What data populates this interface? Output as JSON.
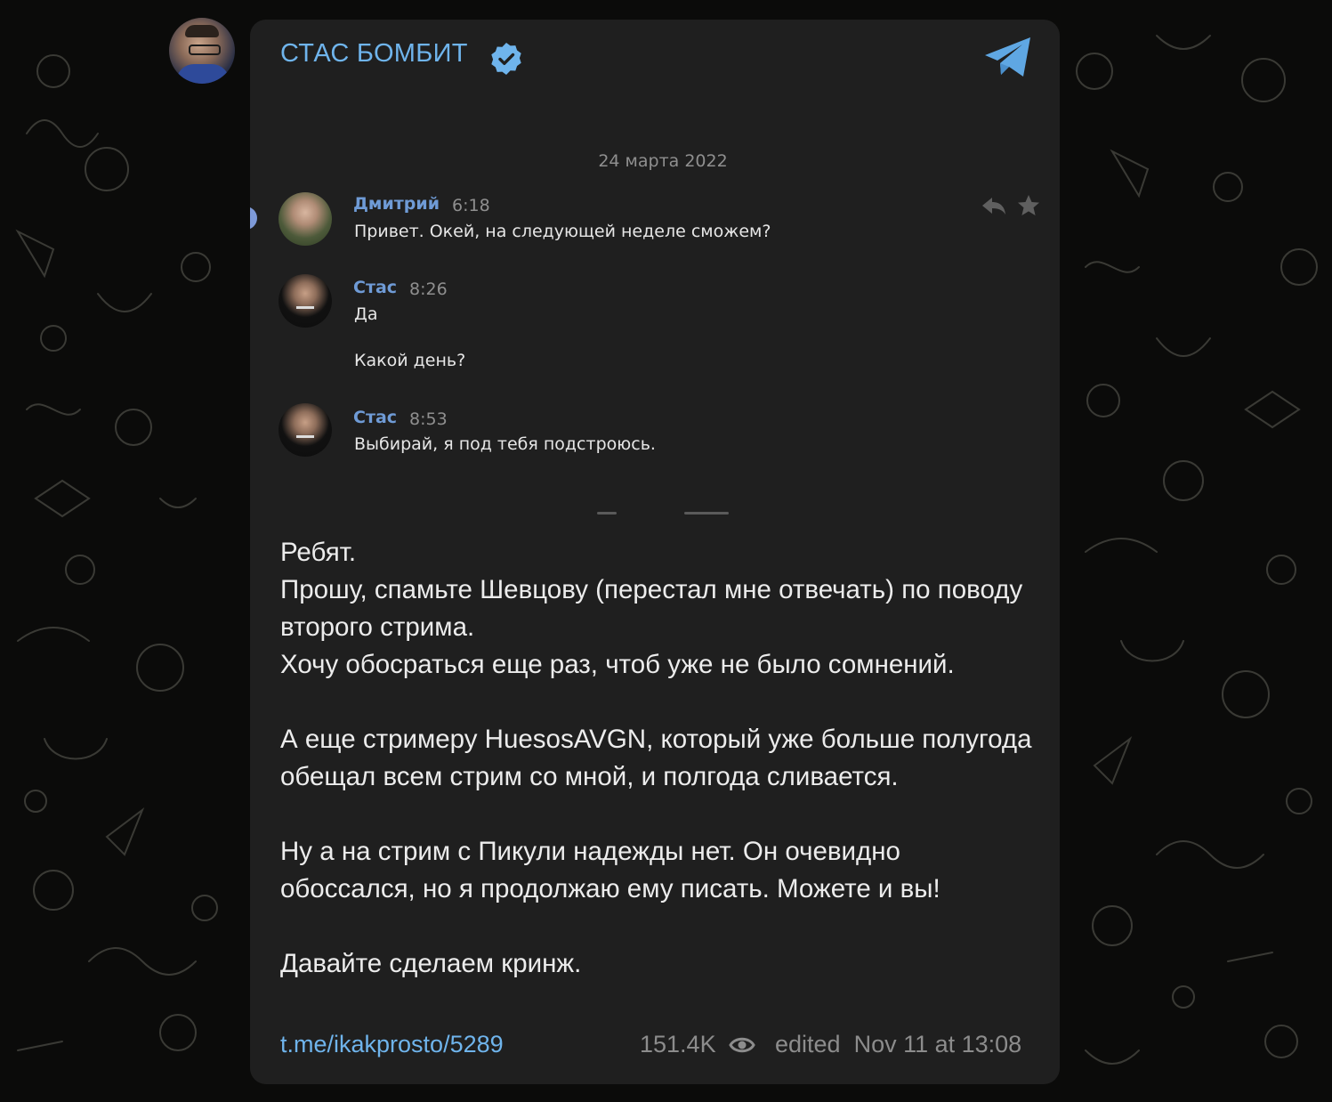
{
  "channel": {
    "title": "СТАС БОМБИТ",
    "verified": true,
    "accent_color": "#6fb4ec"
  },
  "screenshot": {
    "date_separator": "24 марта 2022",
    "messages": [
      {
        "author": "Дмитрий",
        "time": "6:18",
        "text": "Привет. Окей, на следующей неделе сможем?"
      },
      {
        "author": "Стас",
        "time": "8:26",
        "lines": [
          "Да",
          "Какой день?"
        ]
      },
      {
        "author": "Стас",
        "time": "8:53",
        "text": "Выбирай, я под тебя подстроюсь."
      }
    ]
  },
  "post": {
    "paragraphs": [
      "Ребят.",
      "Прошу, спамьте Шевцову (перестал мне отвечать) по поводу второго стрима.",
      "Хочу обосраться еще раз, чтоб уже не было сомнений.",
      "",
      "А еще стримеру HuesosAVGN, который уже больше полугода обещал всем стрим со мной, и полгода сливается.",
      "",
      "Ну а на стрим с Пикули надежды нет. Он очевидно обоссался, но я продолжаю ему писать. Можете и вы!",
      "",
      "Давайте сделаем кринж."
    ]
  },
  "footer": {
    "link": "t.me/ikakprosto/5289",
    "views": "151.4K",
    "edited": "edited  Nov 11 at 13:08"
  },
  "icons": {
    "verified": "verified-badge-icon",
    "telegram": "telegram-logo-icon",
    "reply": "reply-icon",
    "star": "star-icon",
    "views": "eye-icon"
  }
}
